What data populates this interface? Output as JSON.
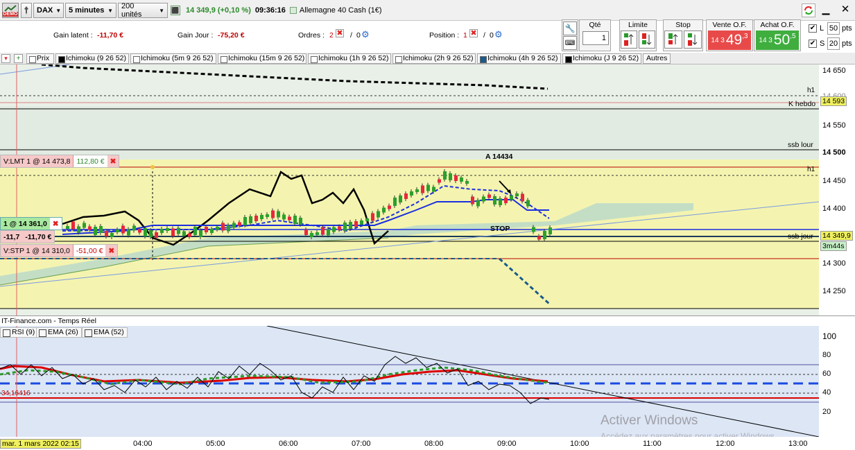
{
  "toolbar": {
    "demo_label": "DEMO",
    "instrument": "DAX",
    "period": "5 minutes",
    "units": "200 unités",
    "quote": "14 349,9 (+0,10 %)",
    "time": "09:36:16",
    "market": "Allemagne 40 Cash (1€)"
  },
  "info": {
    "gain_latent_label": "Gain latent :",
    "gain_latent": "-11,70 €",
    "gain_jour_label": "Gain Jour :",
    "gain_jour": "-75,20 €",
    "ordres_label": "Ordres :",
    "ordres_count": "2",
    "ordres_other": "0",
    "position_label": "Position :",
    "position_count": "1",
    "position_other": "0"
  },
  "trade": {
    "qty_label": "Qté",
    "qty_value": "1",
    "limit_label": "Limite",
    "stop_label": "Stop",
    "sell_label": "Vente O.F.",
    "sell_small": "14 3",
    "sell_big": "49",
    "sell_sup": ",3",
    "buy_label": "Achat O.F.",
    "buy_small": "14 3",
    "buy_big": "50",
    "buy_sup": ",5",
    "l_label": "L",
    "l_value": "50",
    "l_unit": "pts",
    "s_label": "S",
    "s_value": "20",
    "s_unit": "pts"
  },
  "tabs": [
    "Prix",
    "Ichimoku (9 26 52)",
    "Ichimoku (5m 9 26 52)",
    "Ichimoku (15m 9 26 52)",
    "Ichimoku (1h 9 26 52)",
    "Ichimoku (2h 9 26 52)",
    "Ichimoku (4h 9 26 52)",
    "Ichimoku (J 9 26 52)",
    "Autres"
  ],
  "price_axis": {
    "ticks": [
      "14 650",
      "14 600",
      "14 550",
      "14 500",
      "14 450",
      "14 400",
      "14 350",
      "14 300",
      "14 250"
    ],
    "k_hebdo_value": "14 593",
    "current_value": "14 349,9",
    "timer": "3m44s"
  },
  "chart_labels": {
    "h1_top": "h1",
    "k_hebdo": "K hebdo",
    "ssb_lour": "ssb lour",
    "h1_mid": "h1",
    "ssb_jour": "ssb jour",
    "annotation_a": "A 14434",
    "stop": "STOP",
    "source": "IT-Finance.com - Temps Réel"
  },
  "orders": {
    "lmt_label": "V:LMT  1 @ 14 473,8",
    "lmt_value": "112,80 €",
    "pos_label": "1 @ 14 361,0",
    "pos_pts": "-11,7",
    "pos_value": "-11,70 €",
    "stp_label": "V:STP  1 @ 14 310,0",
    "stp_value": "-51,00 €"
  },
  "indicators": {
    "rsi": "RSI (9)",
    "ema26": "EMA (26)",
    "ema52": "EMA (52)",
    "rsi_value": "34,16416",
    "rsi_ticks": [
      "100",
      "80",
      "60",
      "40",
      "20"
    ]
  },
  "xaxis": {
    "start": "mar. 1 mars 2022 02:15",
    "labels": [
      "04:00",
      "05:00",
      "06:00",
      "07:00",
      "08:00",
      "09:00",
      "10:00",
      "11:00",
      "12:00",
      "13:00"
    ]
  },
  "watermark": {
    "title": "Activer Windows",
    "sub": "Accédez aux paramètres pour activer Windows."
  },
  "colors": {
    "bull": "#2ca02c",
    "bear": "#e8283c",
    "kijun": "#1a2ee0",
    "chikou": "#000000",
    "cloud": "#b8d8cc",
    "sell": "#e84a4a",
    "buy": "#3fae3f"
  }
}
